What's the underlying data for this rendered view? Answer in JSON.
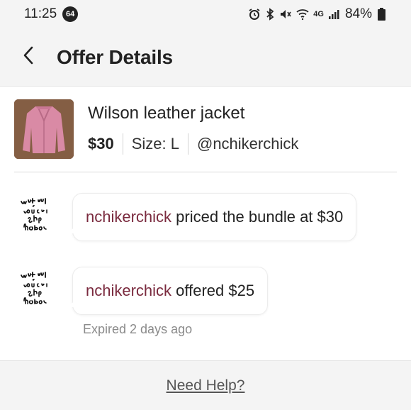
{
  "status_bar": {
    "time": "11:25",
    "notification_count": "64",
    "network": "4G",
    "battery": "84%"
  },
  "header": {
    "back_icon": "chevron-left-icon",
    "title": "Offer Details"
  },
  "listing": {
    "title": "Wilson leather jacket",
    "price": "$30",
    "size": "Size: L",
    "seller": "@nchikerchick"
  },
  "messages": [
    {
      "user": "nchikerchick",
      "text": " priced the bundle at $30"
    },
    {
      "user": "nchikerchick",
      "text": " offered $25",
      "status": "Expired 2 days ago"
    }
  ],
  "footer": {
    "help_label": "Need Help?"
  },
  "colors": {
    "username": "#7a2a3e",
    "jacket": "#d98aa5"
  }
}
